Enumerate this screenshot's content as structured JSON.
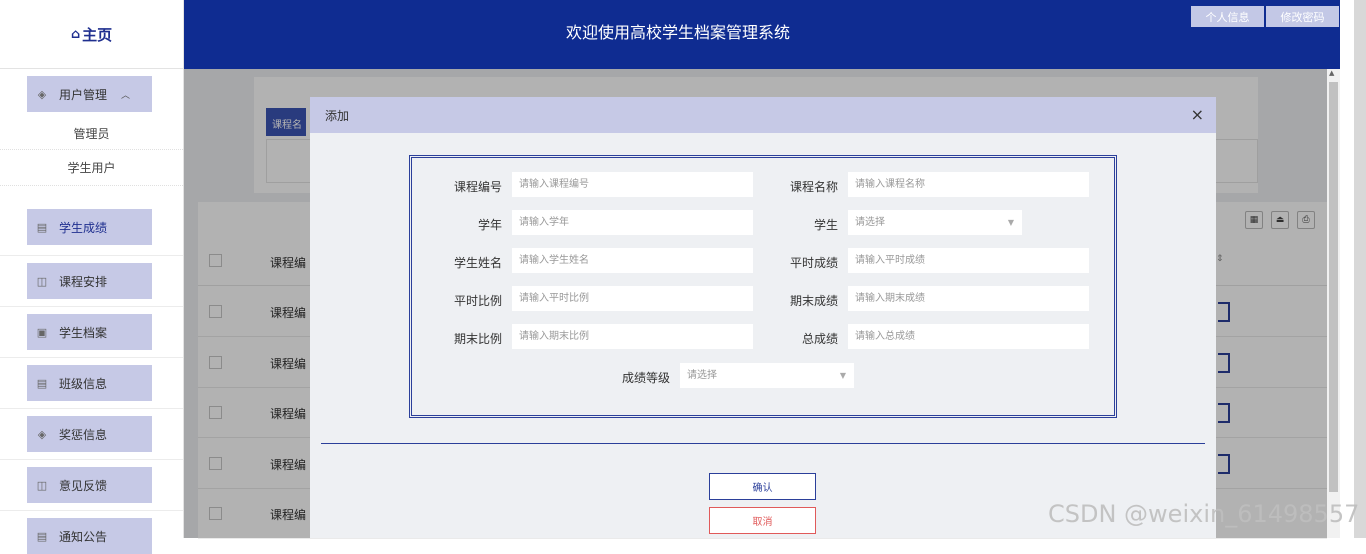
{
  "sidebar": {
    "logo": "主页",
    "groups": [
      {
        "label": "用户管理",
        "caret": "︿"
      },
      {
        "label": "学生成绩"
      },
      {
        "label": "课程安排"
      },
      {
        "label": "学生档案"
      },
      {
        "label": "班级信息"
      },
      {
        "label": "奖惩信息"
      },
      {
        "label": "意见反馈"
      },
      {
        "label": "通知公告"
      }
    ],
    "sub_items": [
      "管理员",
      "学生用户"
    ]
  },
  "header": {
    "title": "欢迎使用高校学生档案管理系统",
    "profile_btn": "个人信息",
    "password_btn": "修改密码"
  },
  "main": {
    "search_btn": "课程名",
    "column_header": "课程编",
    "rows": [
      "课程编",
      "课程编",
      "课程编",
      "课程编",
      "课程编"
    ]
  },
  "dialog": {
    "title": "添加",
    "close": "×",
    "fields": {
      "course_no": {
        "label": "课程编号",
        "placeholder": "请输入课程编号"
      },
      "course_name": {
        "label": "课程名称",
        "placeholder": "请输入课程名称"
      },
      "year": {
        "label": "学年",
        "placeholder": "请输入学年"
      },
      "student": {
        "label": "学生",
        "placeholder": "请选择"
      },
      "student_name": {
        "label": "学生姓名",
        "placeholder": "请输入学生姓名"
      },
      "usual_score": {
        "label": "平时成绩",
        "placeholder": "请输入平时成绩"
      },
      "usual_ratio": {
        "label": "平时比例",
        "placeholder": "请输入平时比例"
      },
      "final_score": {
        "label": "期末成绩",
        "placeholder": "请输入期末成绩"
      },
      "final_ratio": {
        "label": "期末比例",
        "placeholder": "请输入期末比例"
      },
      "total_score": {
        "label": "总成绩",
        "placeholder": "请输入总成绩"
      },
      "grade": {
        "label": "成绩等级",
        "placeholder": "请选择"
      }
    },
    "confirm": "确认",
    "cancel": "取消"
  },
  "watermark": "CSDN @weixin_61498557"
}
